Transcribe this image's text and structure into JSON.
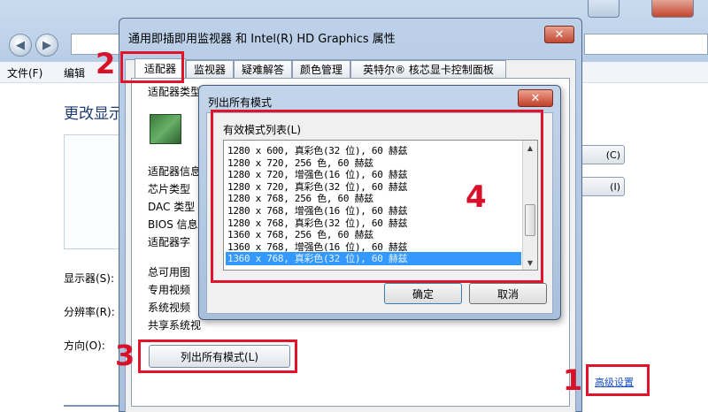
{
  "background_window": {
    "menu": [
      "文件(F)",
      "编辑"
    ],
    "title": "更改显示",
    "labels": [
      "显示器(S):",
      "分辨率(R):",
      "方向(O):"
    ],
    "right_buttons": [
      "(C)",
      "(I)"
    ],
    "advanced_link": "高级设置"
  },
  "properties_window": {
    "title": "通用即插即用监视器 和 Intel(R) HD Graphics 属性",
    "close_glyph": "✕",
    "tabs": [
      "适配器",
      "监视器",
      "疑难解答",
      "颜色管理",
      "英特尔® 核芯显卡控制面板"
    ],
    "adapter_type_label": "适配器类型",
    "info_heading": "适配器信息",
    "info_labels": [
      "芯片类型",
      "DAC 类型",
      "BIOS 信息",
      "适配器字"
    ],
    "memory_labels": [
      "总可用图",
      "专用视频",
      "系统视频",
      "共享系统视"
    ],
    "list_all_button": "列出所有模式(L)"
  },
  "modes_dialog": {
    "title": "列出所有模式",
    "close_glyph": "✕",
    "group_label": "有效模式列表(L)",
    "modes": [
      "1280 x 600, 真彩色(32 位), 60 赫兹",
      "1280 x 720, 256 色, 60 赫兹",
      "1280 x 720, 增强色(16 位), 60 赫兹",
      "1280 x 720, 真彩色(32 位), 60 赫兹",
      "1280 x 768, 256 色, 60 赫兹",
      "1280 x 768, 增强色(16 位), 60 赫兹",
      "1280 x 768, 真彩色(32 位), 60 赫兹",
      "1360 x 768, 256 色, 60 赫兹",
      "1360 x 768, 增强色(16 位), 60 赫兹",
      "1360 x 768, 真彩色(32 位), 60 赫兹"
    ],
    "selected_index": 9,
    "ok_button": "确定",
    "cancel_button": "取消"
  },
  "annotations": {
    "steps": [
      "1",
      "2",
      "3",
      "4"
    ],
    "color": "#e0142a"
  }
}
